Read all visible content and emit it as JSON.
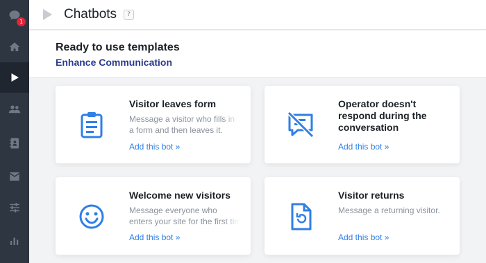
{
  "sidebar": {
    "items": [
      {
        "name": "chat-icon",
        "badge": "1"
      },
      {
        "name": "home-icon"
      },
      {
        "name": "play-icon",
        "active": true
      },
      {
        "name": "users-icon"
      },
      {
        "name": "contacts-icon"
      },
      {
        "name": "mail-icon"
      },
      {
        "name": "sliders-icon"
      },
      {
        "name": "bar-chart-icon"
      }
    ]
  },
  "topbar": {
    "title": "Chatbots",
    "help": "?"
  },
  "header": {
    "title": "Ready to use templates",
    "subtitle": "Enhance Communication"
  },
  "cards": [
    {
      "title": "Visitor leaves form",
      "desc_lines": [
        "Message a visitor who fills in",
        "a form and then leaves it."
      ],
      "link": "Add this bot »",
      "icon": "clipboard-icon"
    },
    {
      "title_lines": [
        "Operator doesn't",
        "respond during the",
        "conversation"
      ],
      "link": "Add this bot »",
      "icon": "no-chat-icon"
    },
    {
      "title": "Welcome new visitors",
      "desc_lines": [
        "Message everyone who",
        "enters your site for the first time."
      ],
      "link": "Add this bot »",
      "icon": "smiley-icon"
    },
    {
      "title": "Visitor returns",
      "desc_lines": [
        "Message a returning visitor."
      ],
      "link": "Add this bot »",
      "icon": "returning-file-icon"
    }
  ],
  "colors": {
    "sidebar_bg": "#2e3641",
    "accent_blue": "#2f7fe6",
    "subtitle_blue": "#2b3c8f",
    "badge_red": "#e0243a"
  }
}
